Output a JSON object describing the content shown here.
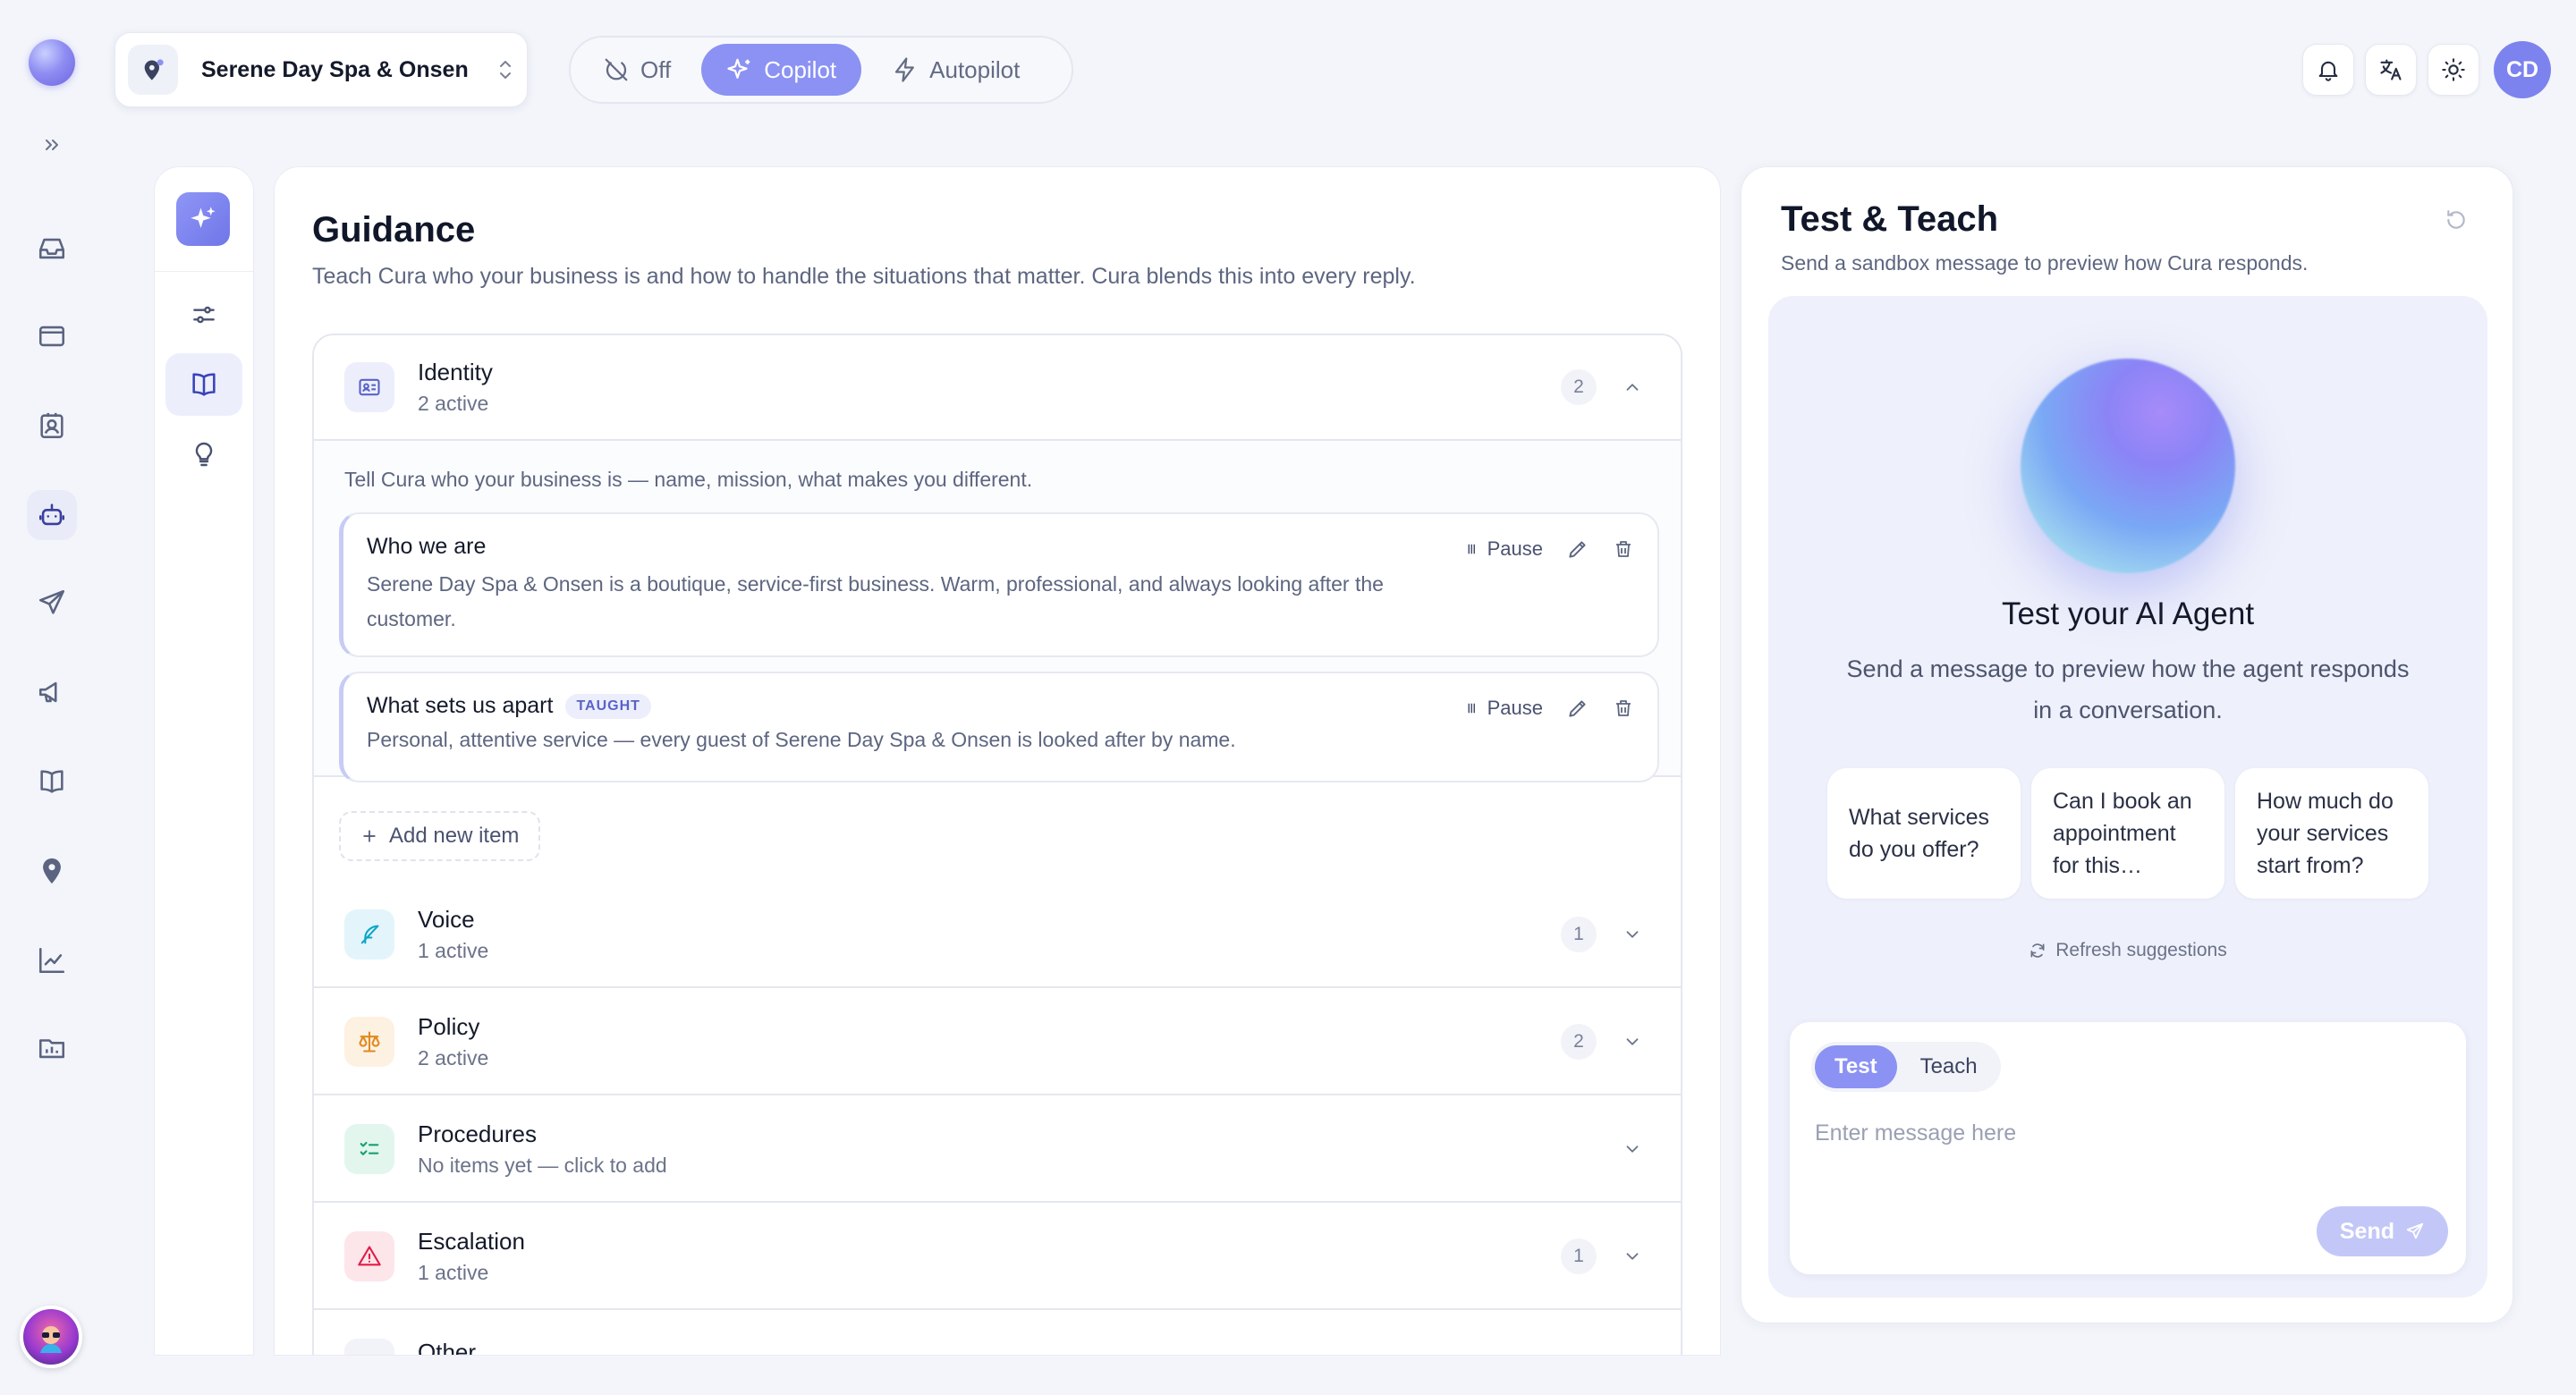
{
  "topbar": {
    "business_name": "Serene Day Spa & Onsen",
    "modes": [
      {
        "label": "Off",
        "icon": "power-off-icon",
        "active": false
      },
      {
        "label": "Copilot",
        "icon": "sparkles-icon",
        "active": true
      },
      {
        "label": "Autopilot",
        "icon": "bolt-icon",
        "active": false
      }
    ],
    "avatar_initials": "CD",
    "accent_color": "#8b92f3"
  },
  "rail": {
    "items": [
      "inbox-icon",
      "browser-icon",
      "contacts-icon",
      "bot-icon",
      "send-icon",
      "megaphone-icon",
      "book-icon",
      "location-icon",
      "chart-icon",
      "report-icon"
    ],
    "active": "bot-icon"
  },
  "subnav": {
    "items": [
      "sliders-icon",
      "book-open-icon",
      "lightbulb-icon"
    ],
    "active": "book-open-icon"
  },
  "guidance": {
    "title": "Guidance",
    "subtitle": "Teach Cura who your business is and how to handle the situations that matter. Cura blends this into every reply.",
    "identity": {
      "name": "Identity",
      "count_label": "2 active",
      "badge": "2",
      "description": "Tell Cura who your business is — name, mission, what makes you different.",
      "items": [
        {
          "title": "Who we are",
          "tag": "",
          "text": "Serene Day Spa & Onsen is a boutique, service-first business. Warm, professional, and always looking after the customer.",
          "pause_label": "Pause"
        },
        {
          "title": "What sets us apart",
          "tag": "TAUGHT",
          "text": "Personal, attentive service — every guest of Serene Day Spa & Onsen is looked after by name.",
          "pause_label": "Pause"
        }
      ],
      "add_label": "Add new item"
    },
    "sections": [
      {
        "name": "Voice",
        "count_label": "1 active",
        "badge": "1",
        "icon": "feather-icon",
        "color": "#0ea5c9",
        "bg": "#e3f5fb"
      },
      {
        "name": "Policy",
        "count_label": "2 active",
        "badge": "2",
        "icon": "scales-icon",
        "color": "#e08a1e",
        "bg": "#fdf1e2"
      },
      {
        "name": "Procedures",
        "count_label": "No items yet — click to add",
        "badge": "",
        "icon": "checklist-icon",
        "color": "#16a36b",
        "bg": "#e2f6ee"
      },
      {
        "name": "Escalation",
        "count_label": "1 active",
        "badge": "1",
        "icon": "warning-icon",
        "color": "#e11d48",
        "bg": "#fde6ea"
      },
      {
        "name": "Other",
        "count_label": "",
        "badge": "",
        "icon": "dots-icon",
        "color": "#6b7389",
        "bg": "#f1f3f8"
      }
    ]
  },
  "test_teach": {
    "title": "Test & Teach",
    "subtitle": "Send a sandbox message to preview how Cura responds.",
    "agent_title": "Test your AI Agent",
    "agent_subtitle": "Send a message to preview how the agent responds in a conversation.",
    "suggestions": [
      "What services do you offer?",
      "Can I book an appointment for this…",
      "How much do your services start from?"
    ],
    "refresh_label": "Refresh suggestions",
    "tabs": [
      {
        "label": "Test",
        "active": true
      },
      {
        "label": "Teach",
        "active": false
      }
    ],
    "input_placeholder": "Enter message here",
    "send_label": "Send"
  }
}
